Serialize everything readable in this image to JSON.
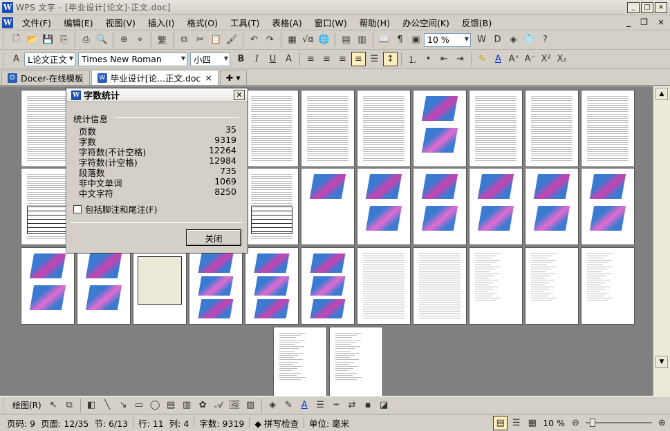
{
  "window": {
    "app_icon": "W",
    "title": "WPS 文字 - [毕业设计[论文]-正文.doc]"
  },
  "menu": {
    "items": [
      "文件(F)",
      "编辑(E)",
      "视图(V)",
      "插入(I)",
      "格式(O)",
      "工具(T)",
      "表格(A)",
      "窗口(W)",
      "帮助(H)",
      "办公空间(K)",
      "反馈(B)"
    ],
    "right": [
      "_",
      "❐",
      "×"
    ]
  },
  "toolbar1": {
    "zoom": "10 %"
  },
  "toolbar2": {
    "style": "L论文正文",
    "font": "Times New Roman",
    "size": "小四"
  },
  "tabs": [
    {
      "label": "Docer-在线模板",
      "active": false
    },
    {
      "label": "毕业设计[论...正文.doc",
      "active": true
    }
  ],
  "dialog": {
    "title": "字数统计",
    "section": "统计信息",
    "stats": [
      {
        "label": "页数",
        "value": "35"
      },
      {
        "label": "字数",
        "value": "9319"
      },
      {
        "label": "字符数(不计空格)",
        "value": "12264"
      },
      {
        "label": "字符数(计空格)",
        "value": "12984"
      },
      {
        "label": "段落数",
        "value": "735"
      },
      {
        "label": "非中文单词",
        "value": "1069"
      },
      {
        "label": "中文字符",
        "value": "8250"
      }
    ],
    "checkbox": "包括脚注和尾注(F)",
    "close_button": "关闭"
  },
  "drawbar": {
    "draw_label": "绘图(R)"
  },
  "status": {
    "page_no": "页码: 9",
    "page": "页面: 12/35",
    "section": "节: 6/13",
    "row": "行: 11",
    "col": "列: 4",
    "words": "字数: 9319",
    "spell": "拼写检查",
    "unit": "单位: 毫米",
    "zoom": "10 %"
  },
  "colors": {
    "title_blue": "#1c4fb0",
    "workspace": "#808080",
    "chrome": "#d4d0c8"
  }
}
